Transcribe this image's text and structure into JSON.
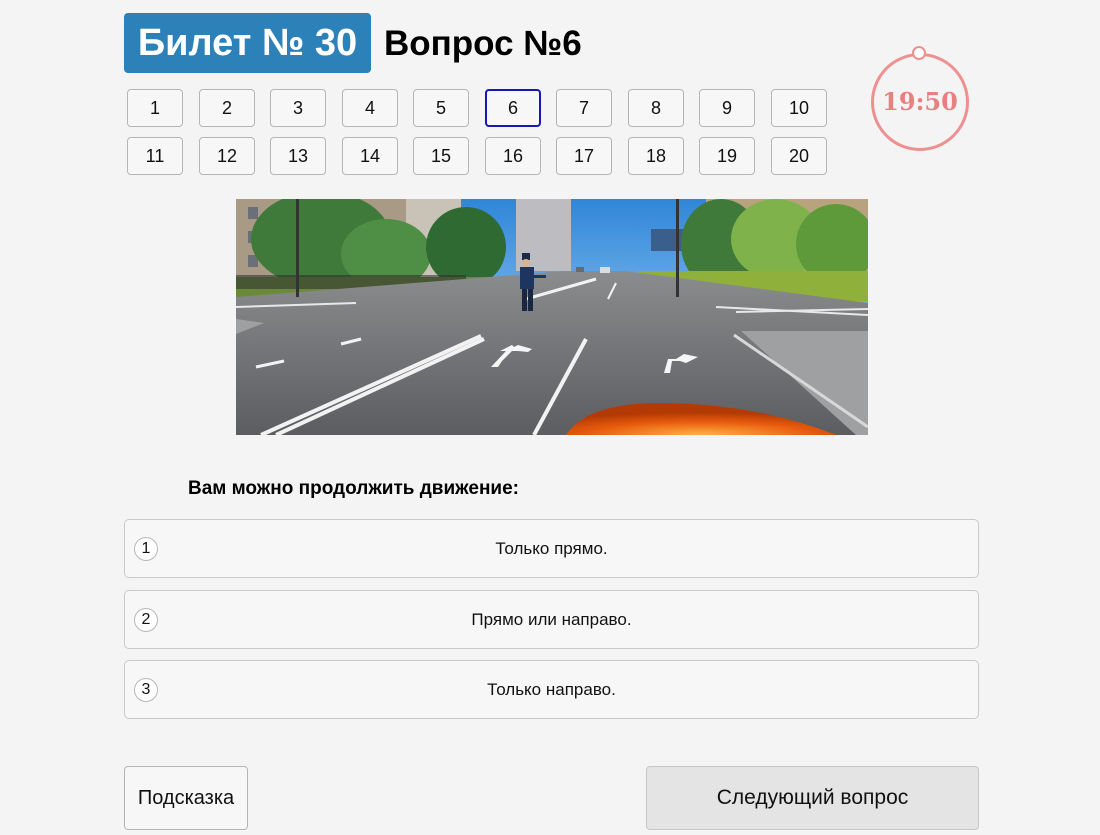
{
  "header": {
    "ticket_label": "Билет № 30",
    "question_label": "Вопрос №6"
  },
  "question_nav": {
    "numbers": [
      "1",
      "2",
      "3",
      "4",
      "5",
      "6",
      "7",
      "8",
      "9",
      "10",
      "11",
      "12",
      "13",
      "14",
      "15",
      "16",
      "17",
      "18",
      "19",
      "20"
    ],
    "current": "6"
  },
  "timer": {
    "time": "19:50",
    "color": "#ea7f7f"
  },
  "question": {
    "prompt": "Вам можно продолжить движение:"
  },
  "answers": [
    {
      "number": "1",
      "text": "Только прямо."
    },
    {
      "number": "2",
      "text": "Прямо или направо."
    },
    {
      "number": "3",
      "text": "Только направо."
    }
  ],
  "buttons": {
    "hint": "Подсказка",
    "next": "Следующий вопрос"
  },
  "colors": {
    "ticket_badge": "#2c82b8",
    "active_question_border": "#1717b5"
  }
}
